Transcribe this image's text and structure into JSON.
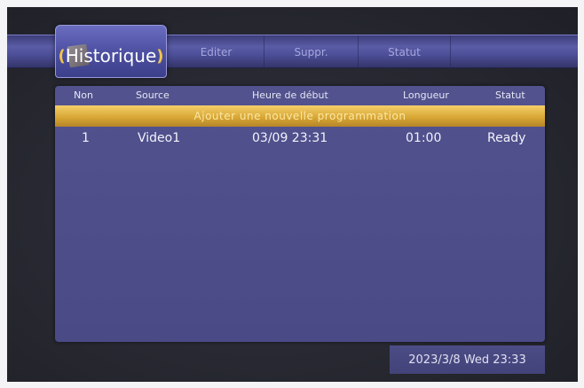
{
  "tabs": [
    {
      "label": "Historique",
      "active": true
    },
    {
      "label": "Editer",
      "active": false
    },
    {
      "label": "Suppr.",
      "active": false
    },
    {
      "label": "Statut",
      "active": false
    }
  ],
  "table": {
    "columns": [
      "Non",
      "Source",
      "Heure de début",
      "Longueur",
      "Statut"
    ],
    "add_row_label": "Ajouter une nouvelle programmation",
    "rows": [
      {
        "num": "1",
        "source": "Video1",
        "start": "03/09 23:31",
        "length": "01:00",
        "status": "Ready"
      }
    ]
  },
  "datetime": "2023/3/8 Wed 23:33",
  "colors": {
    "menu_band": "#4d4f98",
    "panel": "#4e4e8a",
    "highlight": "#d6a432",
    "background": "#26272f"
  }
}
